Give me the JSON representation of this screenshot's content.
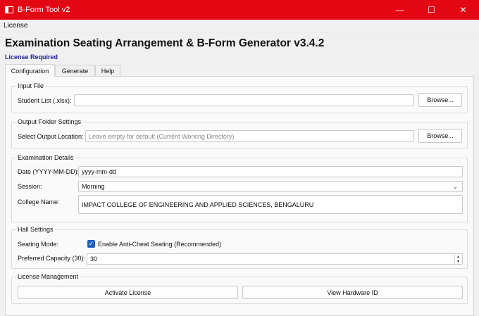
{
  "window": {
    "title": "B-Form Tool v2",
    "controls": {
      "minimize": "—",
      "maximize": "☐",
      "close": "✕"
    }
  },
  "menubar": {
    "items": [
      "License"
    ]
  },
  "header": {
    "title": "Examination Seating Arrangement & B-Form Generator v3.4.2",
    "license_status": "License Required",
    "license_status_color": "#1a1aa6"
  },
  "tabs": [
    "Configuration",
    "Generate",
    "Help"
  ],
  "active_tab": "Configuration",
  "input_file": {
    "group_title": "Input File",
    "student_list_label": "Student List (.xlsx):",
    "student_list_value": "",
    "browse_label": "Browse..."
  },
  "output_folder": {
    "group_title": "Output Folder Settings",
    "location_label": "Select Output Location:",
    "location_placeholder": "Leave empty for default (Current Working Directory)",
    "browse_label": "Browse..."
  },
  "exam_details": {
    "group_title": "Examination Details",
    "date_label": "Date (YYYY-MM-DD):",
    "date_value": "yyyy-mm-dd",
    "session_label": "Session:",
    "session_value": "Morning",
    "college_label": "College Name:",
    "college_value": "IMPACT COLLEGE OF ENGINEERING AND APPLIED SCIENCES, BENGALURU"
  },
  "hall_settings": {
    "group_title": "Hall Settings",
    "seating_mode_label": "Seating Mode:",
    "anti_cheat_label": "Enable Anti-Cheat Seating (Recommended)",
    "anti_cheat_checked": true,
    "capacity_label": "Preferred Capacity (30):",
    "capacity_value": "30"
  },
  "license_mgmt": {
    "group_title": "License Management",
    "activate_label": "Activate License",
    "hardware_label": "View Hardware ID"
  },
  "colors": {
    "titlebar": "#e30613",
    "checkbox": "#1f5fbf"
  }
}
